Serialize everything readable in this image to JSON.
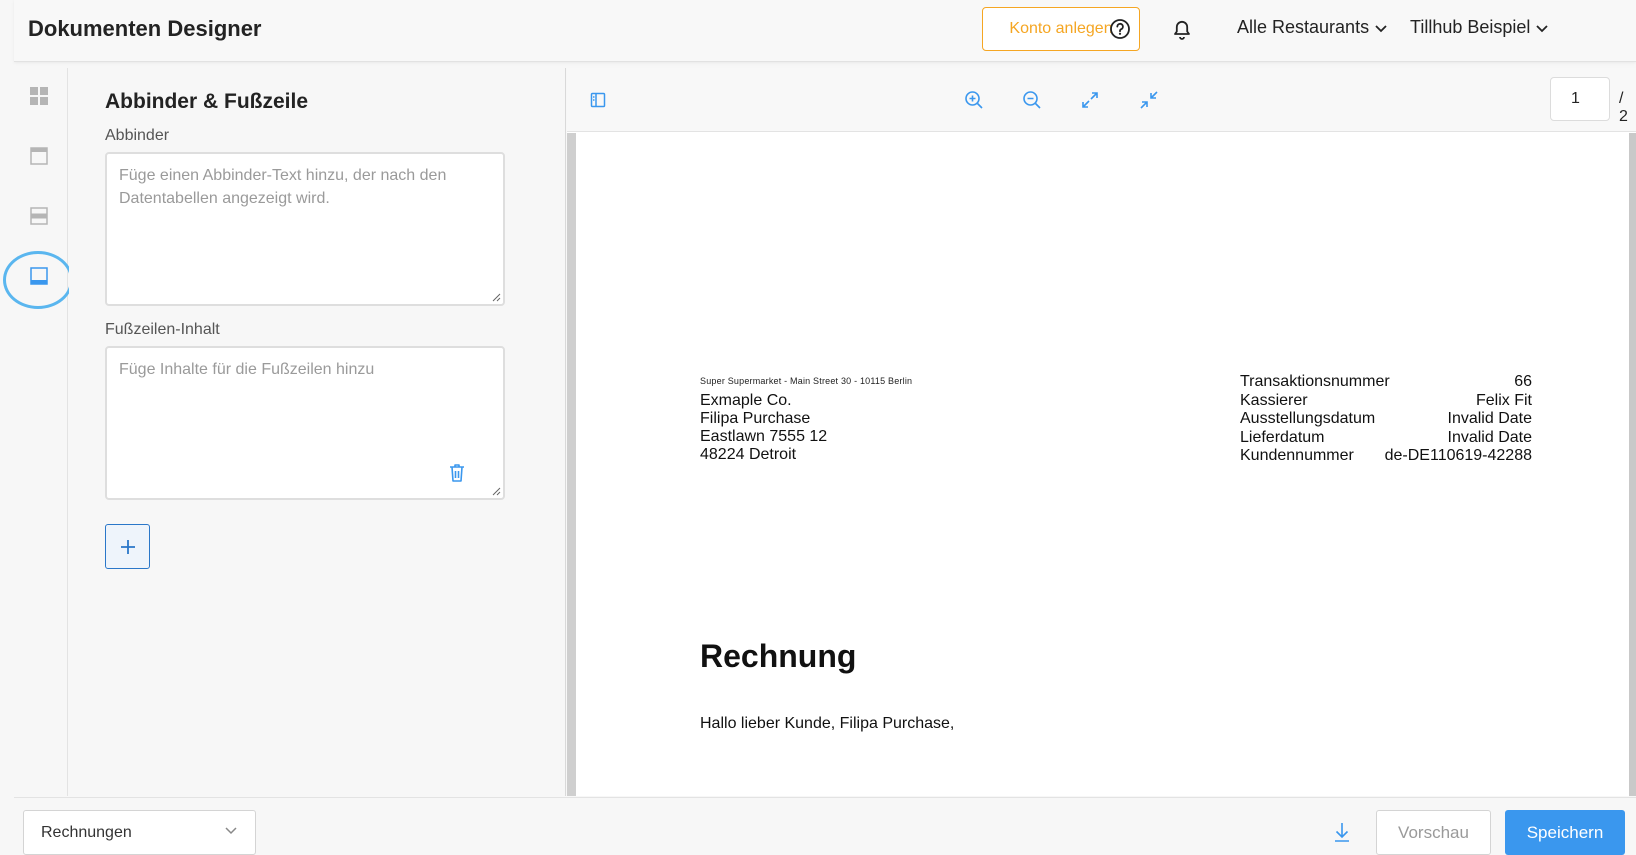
{
  "header": {
    "title": "Dokumenten Designer",
    "konto_button": "Konto anlegen",
    "restaurants_dropdown": "Alle Restaurants",
    "account_dropdown": "Tillhub Beispiel"
  },
  "rail": {
    "items": [
      {
        "icon": "grid-icon"
      },
      {
        "icon": "header-layout-icon"
      },
      {
        "icon": "body-layout-icon"
      },
      {
        "icon": "footer-layout-icon",
        "active": true
      }
    ]
  },
  "panel": {
    "title": "Abbinder & Fußzeile",
    "abbinder_label": "Abbinder",
    "abbinder_placeholder": "Füge einen Abbinder-Text hinzu, der nach den Datentabellen angezeigt wird.",
    "footer_label": "Fußzeilen-Inhalt",
    "footer_placeholder": "Füge Inhalte für die Fußzeilen hinzu"
  },
  "preview": {
    "page_current": "1",
    "page_total": "/ 2"
  },
  "document": {
    "sender_line": "Super Supermarket - Main Street 30 - 10115 Berlin",
    "address": [
      "Exmaple Co.",
      "Filipa Purchase",
      "Eastlawn 7555 12",
      "48224 Detroit"
    ],
    "info": [
      {
        "label": "Transaktionsnummer",
        "value": "66"
      },
      {
        "label": "Kassierer",
        "value": "Felix Fit"
      },
      {
        "label": "Ausstellungsdatum",
        "value": "Invalid Date"
      },
      {
        "label": "Lieferdatum",
        "value": "Invalid Date"
      },
      {
        "label": "Kundennummer",
        "value": "de-DE110619-42288"
      }
    ],
    "title": "Rechnung",
    "greeting": "Hallo lieber Kunde, Filipa Purchase,"
  },
  "footer": {
    "document_type": "Rechnungen",
    "preview_button": "Vorschau",
    "save_button": "Speichern"
  },
  "colors": {
    "accent_orange": "#f5a623",
    "primary_blue": "#3a97ee",
    "icon_blue": "#3a97ee",
    "highlight_circle": "#5ab6ef"
  }
}
